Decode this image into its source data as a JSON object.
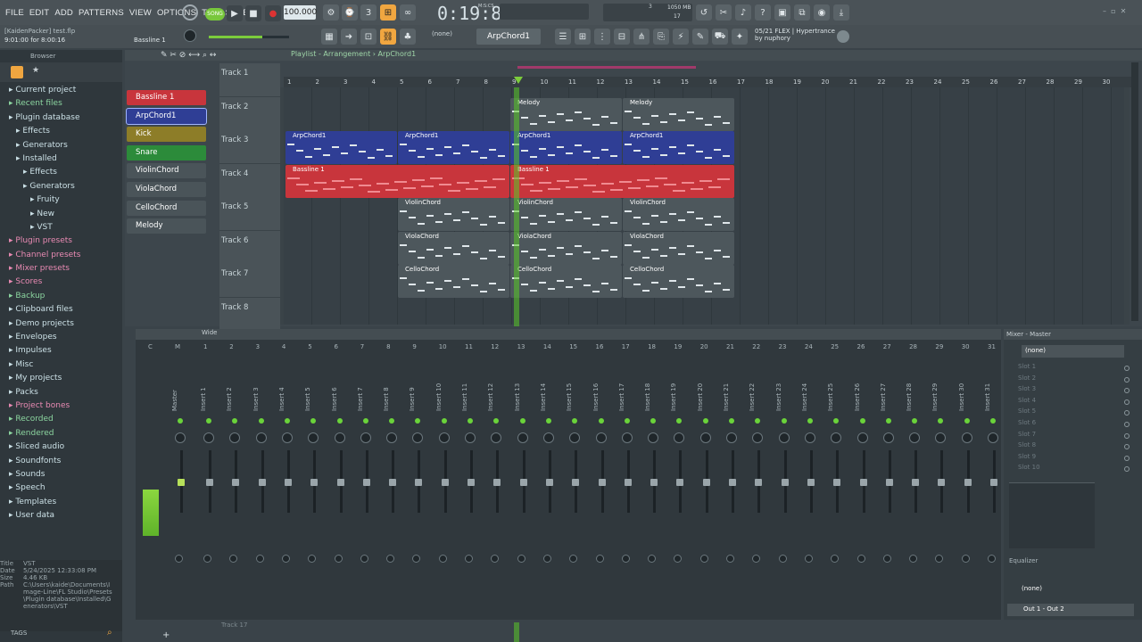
{
  "menu": [
    "FILE",
    "EDIT",
    "ADD",
    "PATTERNS",
    "VIEW",
    "OPTIONS",
    "TOOLS",
    "HELP"
  ],
  "transport": {
    "mode": "SONG",
    "tempo": "100.000",
    "time": "0:19:84",
    "time_unit": "M:S:CS",
    "cpu": "1050 MB",
    "voices": "17",
    "pattern": "3"
  },
  "project": {
    "user": "[KaidenPacker]",
    "file": "test.flp",
    "timer": "9:01:00 for 8:00:16",
    "selected": "Bassline 1"
  },
  "toolbar2": {
    "pattern_sel": "(none)",
    "pattern_name": "ArpChord1",
    "news_line1": "05/21 FLEX | Hypertrance",
    "news_line2": "by nuphory"
  },
  "browser": {
    "title": "Browser",
    "items": [
      {
        "label": "Current project",
        "c": "t",
        "i": 0
      },
      {
        "label": "Recent files",
        "c": "g",
        "i": 0
      },
      {
        "label": "Plugin database",
        "c": "t",
        "i": 0
      },
      {
        "label": "Effects",
        "c": "t",
        "i": 1
      },
      {
        "label": "Generators",
        "c": "t",
        "i": 1
      },
      {
        "label": "Installed",
        "c": "t",
        "i": 1
      },
      {
        "label": "Effects",
        "c": "t",
        "i": 2
      },
      {
        "label": "Generators",
        "c": "t",
        "i": 2
      },
      {
        "label": "Fruity",
        "c": "t",
        "i": 3
      },
      {
        "label": "New",
        "c": "t",
        "i": 3
      },
      {
        "label": "VST",
        "c": "t",
        "i": 3
      },
      {
        "label": "Plugin presets",
        "c": "p",
        "i": 0
      },
      {
        "label": "Channel presets",
        "c": "p",
        "i": 0
      },
      {
        "label": "Mixer presets",
        "c": "p",
        "i": 0
      },
      {
        "label": "Scores",
        "c": "p",
        "i": 0
      },
      {
        "label": "Backup",
        "c": "g",
        "i": 0
      },
      {
        "label": "Clipboard files",
        "c": "t",
        "i": 0
      },
      {
        "label": "Demo projects",
        "c": "t",
        "i": 0
      },
      {
        "label": "Envelopes",
        "c": "t",
        "i": 0
      },
      {
        "label": "Impulses",
        "c": "t",
        "i": 0
      },
      {
        "label": "Misc",
        "c": "t",
        "i": 0
      },
      {
        "label": "My projects",
        "c": "t",
        "i": 0
      },
      {
        "label": "Packs",
        "c": "t",
        "i": 0
      },
      {
        "label": "Project bones",
        "c": "p",
        "i": 0
      },
      {
        "label": "Recorded",
        "c": "g",
        "i": 0
      },
      {
        "label": "Rendered",
        "c": "g",
        "i": 0
      },
      {
        "label": "Sliced audio",
        "c": "t",
        "i": 0
      },
      {
        "label": "Soundfonts",
        "c": "t",
        "i": 0
      },
      {
        "label": "Sounds",
        "c": "t",
        "i": 0
      },
      {
        "label": "Speech",
        "c": "t",
        "i": 0
      },
      {
        "label": "Templates",
        "c": "t",
        "i": 0
      },
      {
        "label": "User data",
        "c": "t",
        "i": 0
      }
    ]
  },
  "info": {
    "Title": "VST",
    "Date": "5/24/2025 12:33:08 PM",
    "Size": "4.46 KB",
    "Path": "C:\\Users\\kaide\\Documents\\Image-Line\\FL Studio\\Presets\\Plugin database\\Installed\\Generators\\VST"
  },
  "tags": "TAGS",
  "playlist": {
    "breadcrumb": "Playlist - Arrangement › ArpChord1",
    "ruler": [
      "1",
      "2",
      "3",
      "4",
      "5",
      "6",
      "7",
      "8",
      "9",
      "10",
      "11",
      "12",
      "13",
      "14",
      "15",
      "16",
      "17",
      "18",
      "19",
      "20",
      "21",
      "22",
      "23",
      "24",
      "25",
      "26",
      "27",
      "28",
      "29",
      "30"
    ]
  },
  "channels": [
    {
      "name": "Bassline 1",
      "color": "#c8353c"
    },
    {
      "name": "ArpChord1",
      "color": "#2f3e95"
    },
    {
      "name": "Kick",
      "color": "#8d7d28"
    },
    {
      "name": "Snare",
      "color": "#2c8b3a"
    },
    {
      "name": "ViolinChord",
      "color": "#4a5459"
    },
    {
      "name": "ViolaChord",
      "color": "#4a5459"
    },
    {
      "name": "CelloChord",
      "color": "#4a5459"
    },
    {
      "name": "Melody",
      "color": "#4a5459"
    }
  ],
  "tracks": [
    "Track 1",
    "Track 2",
    "Track 3",
    "Track 4",
    "Track 5",
    "Track 6",
    "Track 7",
    "Track 8"
  ],
  "clips": [
    {
      "t": 1,
      "label": "Melody",
      "start": 9,
      "len": 4,
      "color": "#4d575c"
    },
    {
      "t": 1,
      "label": "Melody",
      "start": 13,
      "len": 4,
      "color": "#4d575c"
    },
    {
      "t": 2,
      "label": "ArpChord1",
      "start": 1,
      "len": 4,
      "color": "#2f3e95"
    },
    {
      "t": 2,
      "label": "ArpChord1",
      "start": 5,
      "len": 4,
      "color": "#2f3e95"
    },
    {
      "t": 2,
      "label": "ArpChord1",
      "start": 9,
      "len": 4,
      "color": "#2f3e95"
    },
    {
      "t": 2,
      "label": "ArpChord1",
      "start": 13,
      "len": 4,
      "color": "#2f3e95"
    },
    {
      "t": 3,
      "label": "Bassline 1",
      "start": 1,
      "len": 8,
      "color": "#c8353c"
    },
    {
      "t": 3,
      "label": "Bassline 1",
      "start": 9,
      "len": 8,
      "color": "#c8353c"
    },
    {
      "t": 4,
      "label": "ViolinChord",
      "start": 5,
      "len": 4,
      "color": "#4d575c"
    },
    {
      "t": 4,
      "label": "ViolinChord",
      "start": 9,
      "len": 4,
      "color": "#4d575c"
    },
    {
      "t": 4,
      "label": "ViolinChord",
      "start": 13,
      "len": 4,
      "color": "#4d575c"
    },
    {
      "t": 5,
      "label": "ViolaChord",
      "start": 5,
      "len": 4,
      "color": "#4d575c"
    },
    {
      "t": 5,
      "label": "ViolaChord",
      "start": 9,
      "len": 4,
      "color": "#4d575c"
    },
    {
      "t": 5,
      "label": "ViolaChord",
      "start": 13,
      "len": 4,
      "color": "#4d575c"
    },
    {
      "t": 6,
      "label": "CelloChord",
      "start": 5,
      "len": 4,
      "color": "#4d575c"
    },
    {
      "t": 6,
      "label": "CelloChord",
      "start": 9,
      "len": 4,
      "color": "#4d575c"
    },
    {
      "t": 6,
      "label": "CelloChord",
      "start": 13,
      "len": 4,
      "color": "#4d575c"
    }
  ],
  "mixer": {
    "title": "Wide",
    "master": "Master",
    "inserts": [
      "Insert 1",
      "Insert 2",
      "Insert 3",
      "Insert 4",
      "Insert 5",
      "Insert 6",
      "Insert 7",
      "Insert 8",
      "Insert 9",
      "Insert 10",
      "Insert 11",
      "Insert 12",
      "Insert 13",
      "Insert 14",
      "Insert 15",
      "Insert 16",
      "Insert 17",
      "Insert 18",
      "Insert 19",
      "Insert 20",
      "Insert 21",
      "Insert 22",
      "Insert 23",
      "Insert 24",
      "Insert 25",
      "Insert 26",
      "Insert 27",
      "Insert 28",
      "Insert 29",
      "Insert 30",
      "Insert 31"
    ],
    "numbers": [
      "C",
      "M",
      "1",
      "2",
      "3",
      "4",
      "5",
      "6",
      "7",
      "8",
      "9",
      "10",
      "11",
      "12",
      "13",
      "14",
      "15",
      "16",
      "17",
      "18",
      "19",
      "20",
      "21",
      "22",
      "23",
      "24",
      "25",
      "26",
      "27",
      "28",
      "29",
      "30",
      "31"
    ]
  },
  "mixer_master": {
    "title": "Mixer - Master",
    "preset": "(none)",
    "slots": [
      "Slot 1",
      "Slot 2",
      "Slot 3",
      "Slot 4",
      "Slot 5",
      "Slot 6",
      "Slot 7",
      "Slot 8",
      "Slot 9",
      "Slot 10"
    ],
    "eq": "Equalizer",
    "out_preset": "(none)",
    "output": "Out 1 - Out 2"
  },
  "bottom_track": "Track 17"
}
